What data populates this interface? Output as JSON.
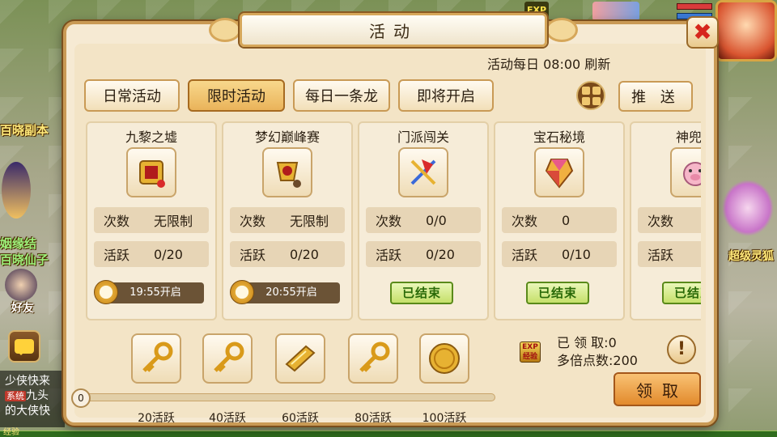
{
  "scene": {
    "left_labels": [
      "百晓副本",
      "姻缘结",
      "百晓仙子",
      "好友"
    ],
    "right_label": "超级灵狐",
    "chat": {
      "line1": "少侠快来",
      "system_tag": "系统",
      "line2": "九头",
      "line3": "的大侠快",
      "exp_label": "经验"
    },
    "top_exp_icon": "EXP"
  },
  "panel": {
    "title": "活动",
    "refresh_note": "活动每日  08:00  刷新"
  },
  "tabs": [
    {
      "label": "日常活动",
      "active": false
    },
    {
      "label": "限时活动",
      "active": true
    },
    {
      "label": "每日一条龙",
      "active": false
    },
    {
      "label": "即将开启",
      "active": false
    }
  ],
  "push_label": "推 送",
  "cards": [
    {
      "name": "九黎之墟",
      "icon": "scroll-seal-icon",
      "count_label": "次数",
      "count_value": "无限制",
      "active_label": "活跃",
      "active_value": "0/20",
      "status": "open",
      "open_time": "19:55开启"
    },
    {
      "name": "梦幻巅峰赛",
      "icon": "trophy-seal-icon",
      "count_label": "次数",
      "count_value": "无限制",
      "active_label": "活跃",
      "active_value": "0/20",
      "status": "open",
      "open_time": "20:55开启"
    },
    {
      "name": "门派闯关",
      "icon": "crossed-flags-icon",
      "count_label": "次数",
      "count_value": "0/0",
      "active_label": "活跃",
      "active_value": "0/20",
      "status": "ended",
      "ended_label": "已结束"
    },
    {
      "name": "宝石秘境",
      "icon": "gem-icon",
      "count_label": "次数",
      "count_value": "0",
      "active_label": "活跃",
      "active_value": "0/10",
      "status": "ended",
      "ended_label": "已结束"
    },
    {
      "name": "神兜兜",
      "icon": "pig-mascot-icon",
      "count_label": "次数",
      "count_value": "",
      "active_label": "活跃",
      "active_value": "",
      "status": "ended",
      "ended_label": "已结束"
    }
  ],
  "rewards": [
    {
      "label": "20活跃",
      "icon": "golden-key-icon"
    },
    {
      "label": "40活跃",
      "icon": "golden-key-icon"
    },
    {
      "label": "60活跃",
      "icon": "gold-bar-icon"
    },
    {
      "label": "80活跃",
      "icon": "golden-key-icon"
    },
    {
      "label": "100活跃",
      "icon": "gold-coin-icon"
    }
  ],
  "progress": {
    "value": "0",
    "fraction": 0
  },
  "claim_info": {
    "exp_book_text": "EXP 经验",
    "claimed": "已 领 取:0",
    "multiplier": "多倍点数:200",
    "claim_button": "领取"
  },
  "colors": {
    "panel_bg": "#f6ead3",
    "panel_border": "#c99a55",
    "active_tab": "#eab35a",
    "ended_green": "#c5e06a",
    "claim_orange": "#e28a2c",
    "close_red": "#d6261c"
  }
}
